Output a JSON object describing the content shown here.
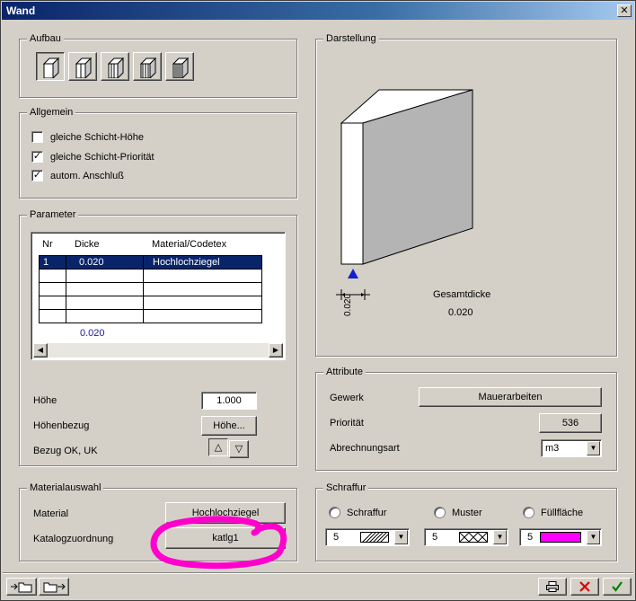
{
  "window": {
    "title": "Wand",
    "close_label": "✕"
  },
  "aufbau": {
    "legend": "Aufbau"
  },
  "allgemein": {
    "legend": "Allgemein",
    "checks": [
      {
        "label": "gleiche Schicht-Höhe",
        "checked": false
      },
      {
        "label": "gleiche Schicht-Priorität",
        "checked": true
      },
      {
        "label": "autom. Anschluß",
        "checked": true
      }
    ]
  },
  "parameter": {
    "legend": "Parameter",
    "columns": [
      "Nr",
      "Dicke",
      "Material/Codetex"
    ],
    "rows": [
      {
        "nr": "1",
        "dicke": "0.020",
        "material": "Hochlochziegel"
      }
    ],
    "total": "0.020",
    "hoehe_label": "Höhe",
    "hoehe_value": "1.000",
    "hoehenbezug_label": "Höhenbezug",
    "hoehenbezug_button": "Höhe...",
    "bezug_label": "Bezug OK, UK"
  },
  "darstellung": {
    "legend": "Darstellung",
    "dim_value": "0.020",
    "gesamtdicke_label": "Gesamtdicke",
    "gesamtdicke_value": "0.020"
  },
  "attribute": {
    "legend": "Attribute",
    "gewerk_label": "Gewerk",
    "gewerk_button": "Mauerarbeiten",
    "prioritaet_label": "Priorität",
    "prioritaet_value": "536",
    "abrechnung_label": "Abrechnungsart",
    "abrechnung_value": "m3"
  },
  "materialauswahl": {
    "legend": "Materialauswahl",
    "material_label": "Material",
    "material_button": "Hochlochziegel",
    "katalog_label": "Katalogzuordnung",
    "katalog_button": "katlg1",
    "annotation_color": "#ff00cc"
  },
  "schraffur": {
    "legend": "Schraffur",
    "options": [
      "Schraffur",
      "Muster",
      "Füllfläche"
    ],
    "values": [
      "5",
      "5",
      "5"
    ],
    "fill_color": "#ff00ff"
  }
}
